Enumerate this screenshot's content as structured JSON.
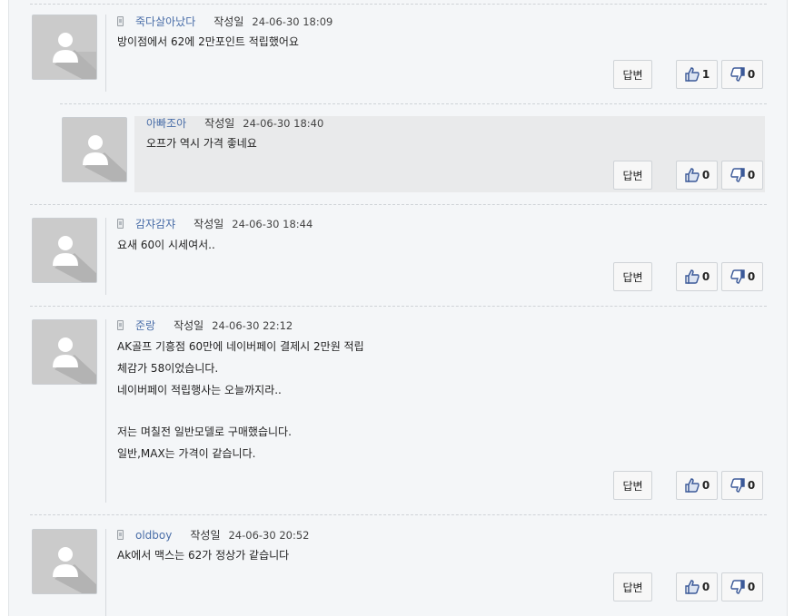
{
  "labels": {
    "written": "작성일",
    "reply_button": "답변"
  },
  "comments": [
    {
      "author": "죽다살아났다",
      "date": "24-06-30 18:09",
      "lines": [
        "방이점에서 62에 2만포인트 적립했어요"
      ],
      "likes": "1",
      "dislikes": "0",
      "is_reply": false,
      "device_icon": "phone-icon"
    },
    {
      "author": "아빠조아",
      "date": "24-06-30 18:40",
      "lines": [
        "오프가 역시 가격 좋네요"
      ],
      "likes": "0",
      "dislikes": "0",
      "is_reply": true
    },
    {
      "author": "감쟈감쟈",
      "date": "24-06-30 18:44",
      "lines": [
        "요새 60이 시세여서.."
      ],
      "likes": "0",
      "dislikes": "0",
      "is_reply": false,
      "device_icon": "phone-icon"
    },
    {
      "author": "준랑",
      "date": "24-06-30 22:12",
      "lines": [
        "AK골프 기흥점 60만에 네이버페이 결제시 2만원 적립",
        "체감가 58이었습니다.",
        "네이버페이 적립행사는 오늘까지라..",
        "",
        "저는 며칠전 일반모델로 구매했습니다.",
        "일반,MAX는 가격이 같습니다."
      ],
      "likes": "0",
      "dislikes": "0",
      "is_reply": false,
      "device_icon": "phone-icon"
    },
    {
      "author": "oldboy",
      "date": "24-06-30 20:52",
      "lines": [
        "Ak에서 맥스는 62가 정상가 같습니다"
      ],
      "likes": "0",
      "dislikes": "0",
      "is_reply": false,
      "device_icon": "phone-icon"
    }
  ],
  "colors": {
    "author": "#4a6ea8",
    "background": "#f4f6f8",
    "reply_background": "#e9eaeb",
    "thumb_icon": "#3b5998"
  }
}
